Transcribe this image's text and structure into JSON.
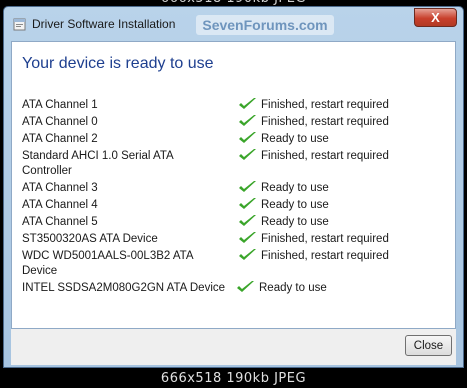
{
  "image_caption": {
    "bottom_label": "666x518  190kb  JPEG"
  },
  "window": {
    "title": "Driver Software Installation",
    "watermark": "SevenForums.com",
    "close_glyph": "X",
    "heading": "Your device is ready to use"
  },
  "devices": [
    {
      "name": "ATA Channel 1",
      "status": "Finished, restart required"
    },
    {
      "name": "ATA Channel 0",
      "status": "Finished, restart required"
    },
    {
      "name": "ATA Channel 2",
      "status": "Ready to use"
    },
    {
      "name": "Standard AHCI 1.0 Serial ATA Controller",
      "status": "Finished, restart required"
    },
    {
      "name": "ATA Channel 3",
      "status": "Ready to use"
    },
    {
      "name": "ATA Channel 4",
      "status": "Ready to use"
    },
    {
      "name": "ATA Channel 5",
      "status": "Ready to use"
    },
    {
      "name": "ST3500320AS ATA Device",
      "status": "Finished, restart required"
    },
    {
      "name": "WDC WD5001AALS-00L3B2 ATA Device",
      "status": "Finished, restart required"
    },
    {
      "name": "INTEL SSDSA2M080G2GN ATA Device",
      "status": "Ready to use"
    }
  ],
  "footer": {
    "close_label": "Close"
  },
  "icons": {
    "title": "driver-install-icon",
    "status": "green-check-icon"
  },
  "colors": {
    "heading": "#1e3f8f",
    "check": "#3aa52a",
    "close_button": "#c8402c"
  }
}
